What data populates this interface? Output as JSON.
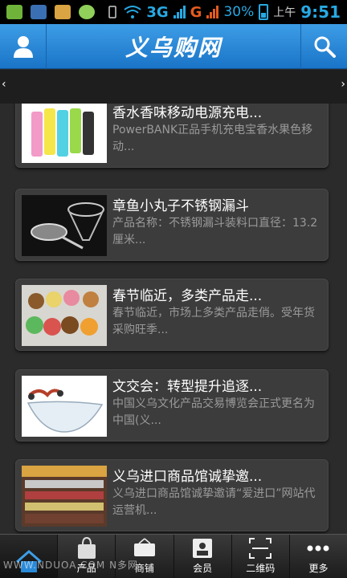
{
  "status_bar": {
    "network_1": "3G",
    "network_2": "G",
    "battery": "30%",
    "ampm": "上午",
    "time": "9:51"
  },
  "header": {
    "logo": "义乌购网",
    "user_icon": "user-icon",
    "search_icon": "search-icon"
  },
  "banner": {
    "prev": "‹",
    "next": "›"
  },
  "news": [
    {
      "title": "香水香味移动电源充电...",
      "desc": "PowerBANK正品手机充电宝香水果色移动...",
      "image": "power-bank-image"
    },
    {
      "title": "章鱼小丸子不锈钢漏斗",
      "desc": "产品名称：不锈钢漏斗装料口直径：13.2厘米...",
      "image": "funnel-image"
    },
    {
      "title": "春节临近，多类产品走...",
      "desc": "春节临近，市场上多类产品走俏。受年货采购旺季...",
      "image": "plush-toys-image"
    },
    {
      "title": "文交会：转型提升追逐...",
      "desc": "中国义乌文化产品交易博览会正式更名为中国(义...",
      "image": "glass-bowl-image"
    },
    {
      "title": "义乌进口商品馆诚挚邀...",
      "desc": "义乌进口商品馆诚挚邀请“爱进口”网站代运营机...",
      "image": "shop-image"
    }
  ],
  "tabs": [
    {
      "label": "",
      "icon": "home-icon"
    },
    {
      "label": "产品",
      "icon": "shopping-bag-icon"
    },
    {
      "label": "商铺",
      "icon": "open-sign-icon"
    },
    {
      "label": "会员",
      "icon": "member-card-icon"
    },
    {
      "label": "二维码",
      "icon": "qr-scan-icon"
    },
    {
      "label": "更多",
      "icon": "more-dots-icon"
    }
  ],
  "watermark": "WWW.NDUOA.COM N多网",
  "colors": {
    "header": "#2a8ad8",
    "accent": "#27a9e3",
    "card": "#3c3c3c",
    "background": "#2b2b2b"
  }
}
